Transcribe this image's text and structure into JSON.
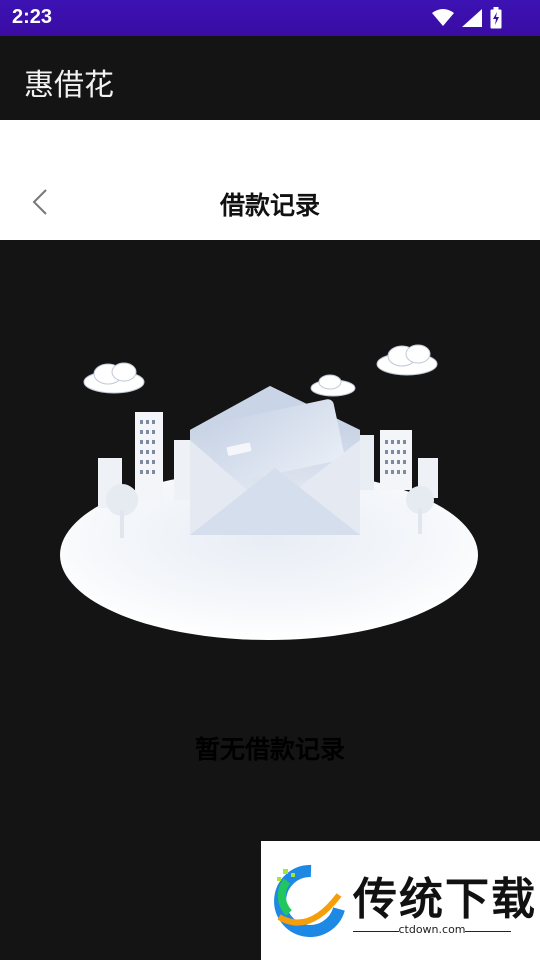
{
  "status_bar": {
    "time": "2:23",
    "icons": [
      "wifi-icon",
      "signal-icon",
      "battery-charging-icon"
    ]
  },
  "app_bar": {
    "title": "惠借花"
  },
  "header": {
    "back_icon": "chevron-left-icon",
    "title": "借款记录"
  },
  "empty_state": {
    "illustration": "envelope-city-illustration",
    "message": "暂无借款记录"
  },
  "watermark": {
    "title": "传统下载",
    "subtitle": "ctdown.com",
    "logo": "ctdown-logo"
  },
  "colors": {
    "status_bar": "#3a0ca3",
    "app_bar": "#141414",
    "background": "#141414",
    "header": "#ffffff"
  }
}
